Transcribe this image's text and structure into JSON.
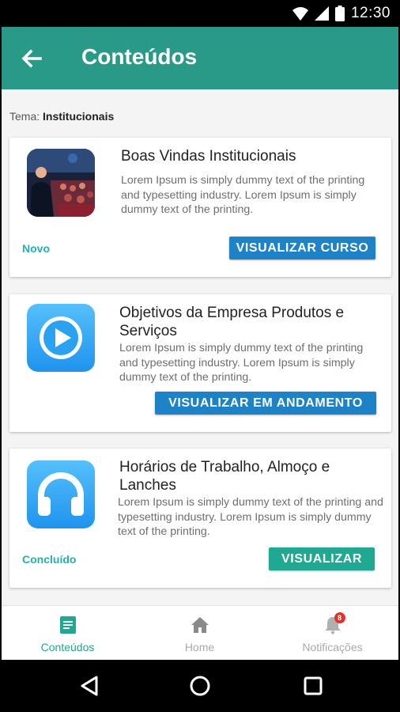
{
  "status_bar": {
    "time": "12:30"
  },
  "app_bar": {
    "title": "Conteúdos"
  },
  "tema": {
    "label": "Tema:",
    "value": "Institucionais"
  },
  "cards": [
    {
      "title": "Boas Vindas Institucionais",
      "description": "Lorem Ipsum is simply dummy text of the printing and typesetting industry. Lorem Ipsum is simply dummy text of the printing.",
      "status": "Novo",
      "button": "VISUALIZAR CURSO",
      "thumb": "photo-presentation"
    },
    {
      "title": "Objetivos da Empresa Produtos e Serviços",
      "description": "Lorem Ipsum is simply dummy text of the printing and typesetting industry. Lorem Ipsum is simply dummy text of the printing.",
      "status": "",
      "button": "VISUALIZAR  EM ANDAMENTO",
      "thumb": "play-icon"
    },
    {
      "title": "Horários de Trabalho, Almoço e Lanches",
      "description": "Lorem Ipsum is simply dummy text of the printing and typesetting industry. Lorem Ipsum is simply dummy text of the printing.",
      "status": "Concluído",
      "button": "VISUALIZAR",
      "thumb": "headphones-icon"
    }
  ],
  "bottom_nav": {
    "items": [
      {
        "label": "Conteúdos",
        "icon": "document-icon"
      },
      {
        "label": "Home",
        "icon": "home-icon"
      },
      {
        "label": "Notificações",
        "icon": "bell-icon",
        "badge": "8"
      }
    ]
  },
  "colors": {
    "app_bar": "#2a9a88",
    "accent_teal": "#22b3ad",
    "button_blue": "#1d83c6",
    "button_teal": "#1fa992",
    "icon_blue": "#2aa2f2"
  }
}
